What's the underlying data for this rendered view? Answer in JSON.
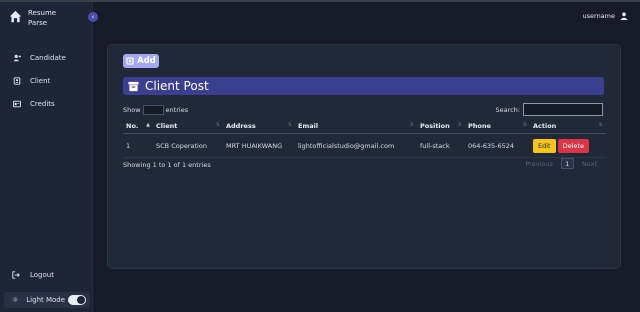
{
  "brand": {
    "line1": "Resume",
    "line2": "Parse"
  },
  "sidebar": {
    "items": [
      {
        "label": "Candidate",
        "icon": "user-plus-icon"
      },
      {
        "label": "Client",
        "icon": "contacts-icon"
      },
      {
        "label": "Credits",
        "icon": "id-card-icon"
      }
    ],
    "logout": "Logout",
    "light_mode": "Light Mode",
    "light_mode_on": true
  },
  "header": {
    "username": "username"
  },
  "main": {
    "add_label": "Add",
    "title": "Client Post",
    "show_label": "Show",
    "entries_label": "entries",
    "search_label": "Search:",
    "search_value": "",
    "columns": [
      "No.",
      "Client",
      "Address",
      "Email",
      "Position",
      "Phone",
      "Action"
    ],
    "rows": [
      {
        "no": "1",
        "client": "SCB Coperation",
        "address": "MRT HUAIKWANG",
        "email": "lightofficialstudio@gmail.com",
        "position": "full-stack",
        "phone": "064-635-6524",
        "edit": "Edit",
        "delete": "Delete"
      }
    ],
    "showing_text": "Showing 1 to 1 of 1 entries",
    "pagination": {
      "previous": "Previous",
      "current": "1",
      "next": "Next"
    }
  },
  "colors": {
    "background": "#171b29",
    "sidebar": "#1e2536",
    "card": "#212838",
    "accent": "#3b3f8f",
    "add_button": "#a5a8f1",
    "edit": "#f5c518",
    "delete": "#dc3545"
  }
}
